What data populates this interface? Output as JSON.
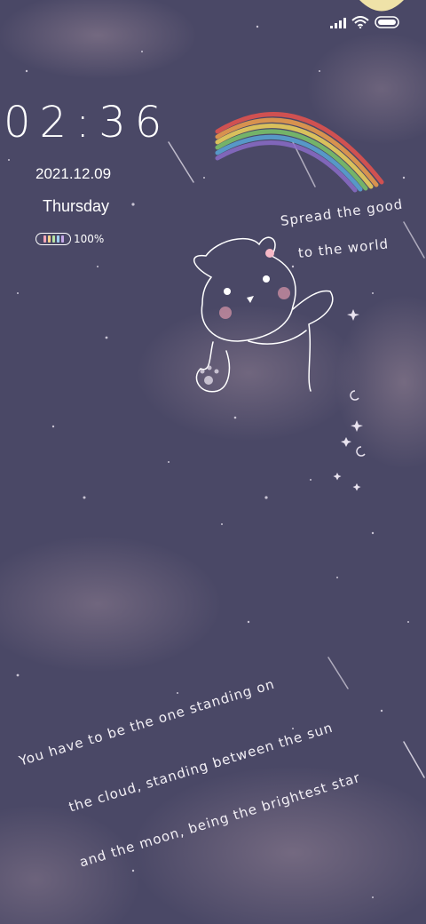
{
  "status_bar": {
    "icons": [
      "signal-bars-icon",
      "wifi-icon",
      "battery-icon"
    ]
  },
  "lockscreen": {
    "time": "02:36",
    "date": "2021.12.09",
    "weekday": "Thursday",
    "battery_percent_label": "100%",
    "battery_level": 1.0,
    "battery_cell_colors": [
      "#f3a6b8",
      "#f7d08a",
      "#b7e3a4",
      "#9fd0f0",
      "#c4a8e8"
    ]
  },
  "wallpaper": {
    "quote_top": [
      "Spread the good",
      "to the world"
    ],
    "quote_bottom": [
      "You have to be the one standing on",
      "the cloud, standing between the sun",
      "and the moon, being the brightest star"
    ],
    "rainbow_colors": [
      "#e8534e",
      "#f0a04b",
      "#f2d65b",
      "#7cc66a",
      "#5aa6d8",
      "#8a6cc8"
    ]
  }
}
